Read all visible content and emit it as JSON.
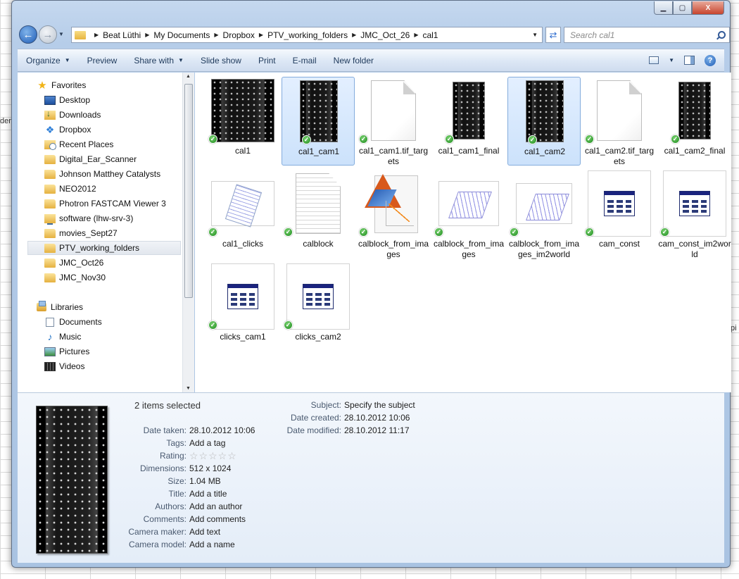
{
  "background": {
    "left_cell_text": "der",
    "right_cell_text": "pi"
  },
  "window": {
    "controls": {
      "minimize": "▁",
      "maximize": "▢",
      "close": "X"
    }
  },
  "address_bar": {
    "crumbs": [
      "Beat Lüthi",
      "My Documents",
      "Dropbox",
      "PTV_working_folders",
      "JMC_Oct_26",
      "cal1"
    ]
  },
  "search": {
    "placeholder": "Search cal1"
  },
  "toolbar": {
    "organize": "Organize",
    "preview": "Preview",
    "share_with": "Share with",
    "slide_show": "Slide show",
    "print": "Print",
    "email": "E-mail",
    "new_folder": "New folder"
  },
  "nav": {
    "favorites_label": "Favorites",
    "favorites": [
      "Desktop",
      "Downloads",
      "Dropbox",
      "Recent Places",
      "Digital_Ear_Scanner",
      "Johnson Matthey Catalysts",
      "NEO2012",
      "Photron FASTCAM Viewer 3",
      "software (lhw-srv-3)",
      "movies_Sept27",
      "PTV_working_folders",
      "JMC_Oct26",
      "JMC_Nov30"
    ],
    "selected": "PTV_working_folders",
    "libraries_label": "Libraries",
    "libraries": [
      "Documents",
      "Music",
      "Pictures",
      "Videos"
    ]
  },
  "files": [
    {
      "name": "cal1",
      "kind": "image-dark",
      "selected": false
    },
    {
      "name": "cal1_cam1",
      "kind": "image-dark-tall",
      "selected": true
    },
    {
      "name": "cal1_cam1.tif_targets",
      "kind": "blank-doc",
      "selected": false
    },
    {
      "name": "cal1_cam1_final",
      "kind": "image-dark-tall2",
      "selected": false
    },
    {
      "name": "cal1_cam2",
      "kind": "image-dark-tall",
      "selected": true
    },
    {
      "name": "cal1_cam2.tif_targets",
      "kind": "blank-doc",
      "selected": false
    },
    {
      "name": "cal1_cam2_final",
      "kind": "image-dark-tall2",
      "selected": false
    },
    {
      "name": "cal1_clicks",
      "kind": "clicks-plot",
      "selected": false
    },
    {
      "name": "calblock",
      "kind": "lined-doc",
      "selected": false
    },
    {
      "name": "calblock_from_images",
      "kind": "matlab-figure",
      "selected": false
    },
    {
      "name": "calblock_from_images",
      "kind": "plot-3d",
      "selected": false
    },
    {
      "name": "calblock_from_images_im2world",
      "kind": "plot-3d-small",
      "selected": false
    },
    {
      "name": "cam_const",
      "kind": "table",
      "selected": false
    },
    {
      "name": "cam_const_im2world",
      "kind": "table",
      "selected": false
    },
    {
      "name": "clicks_cam1",
      "kind": "table",
      "selected": false
    },
    {
      "name": "clicks_cam2",
      "kind": "table",
      "selected": false
    }
  ],
  "details": {
    "title": "2 items selected",
    "left": [
      {
        "label": "Date taken:",
        "value": "28.10.2012 10:06"
      },
      {
        "label": "Tags:",
        "value": "Add a tag"
      },
      {
        "label": "Rating:",
        "value": "☆☆☆☆☆"
      },
      {
        "label": "Dimensions:",
        "value": "512 x 1024"
      },
      {
        "label": "Size:",
        "value": "1.04 MB"
      },
      {
        "label": "Title:",
        "value": "Add a title"
      },
      {
        "label": "Authors:",
        "value": "Add an author"
      },
      {
        "label": "Comments:",
        "value": "Add comments"
      },
      {
        "label": "Camera maker:",
        "value": "Add text"
      },
      {
        "label": "Camera model:",
        "value": "Add a name"
      }
    ],
    "right": [
      {
        "label": "Subject:",
        "value": "Specify the subject"
      },
      {
        "label": "Date created:",
        "value": "28.10.2012 10:06"
      },
      {
        "label": "Date modified:",
        "value": "28.10.2012 11:17"
      }
    ]
  }
}
